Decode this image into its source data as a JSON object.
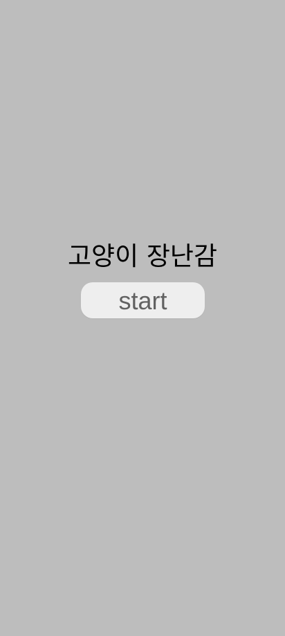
{
  "app": {
    "title": "고양이 장난감"
  },
  "start_button": {
    "label": "start"
  },
  "colors": {
    "background": "#bdbdbd",
    "button_background": "#eeeeee",
    "title_text": "#000000",
    "button_text": "#616161"
  }
}
